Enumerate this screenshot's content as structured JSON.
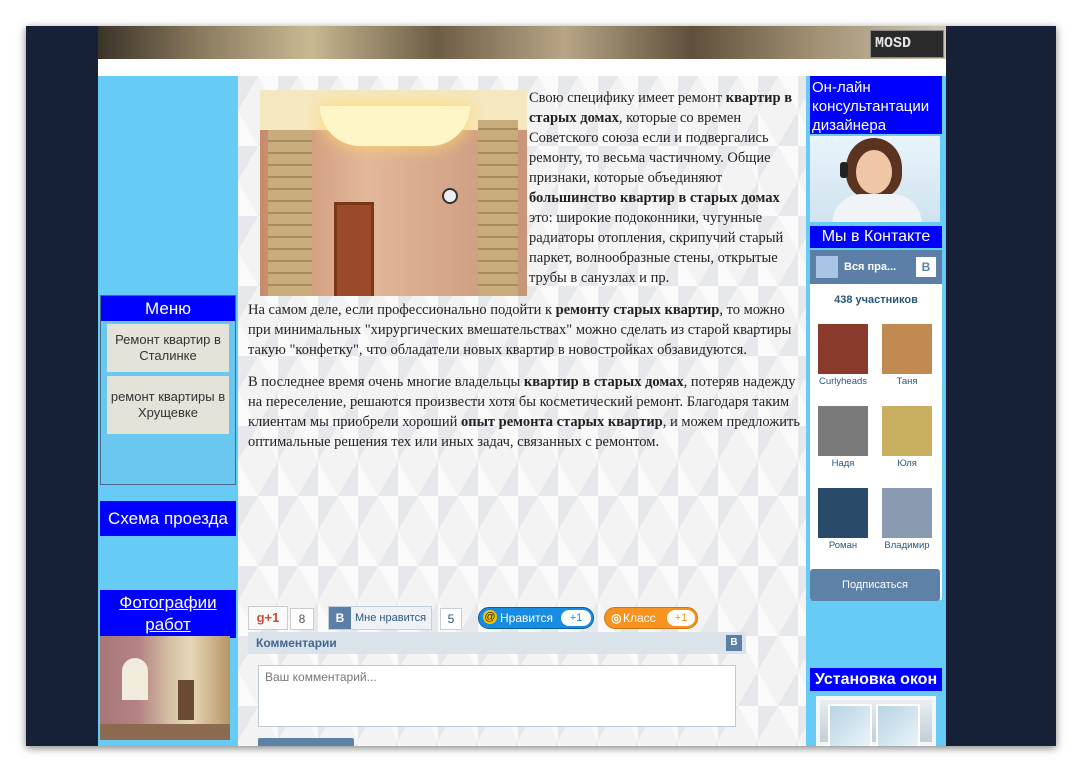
{
  "header": {
    "logo_text": "MOSD"
  },
  "left": {
    "menu_title": "Меню",
    "menu_items": [
      {
        "label": "Ремонт квартир в Сталинке"
      },
      {
        "label": "ремонт квартиры в Хрущевке"
      }
    ],
    "schema_link": "Схема проезда",
    "photos_link": "Фотографии работ"
  },
  "article": {
    "p1": [
      {
        "t": "Свою специфику имеет ремонт ",
        "b": false
      },
      {
        "t": "квартир в старых домах",
        "b": true
      },
      {
        "t": ", которые со времен Советского союза если и подвергались ремонту, то весьма частичному. Общие признаки, которые объединяют ",
        "b": false
      },
      {
        "t": "большинство квартир в старых домах",
        "b": true
      },
      {
        "t": " это: широкие подоконники, чугунные радиаторы отопления, скрипучий старый паркет, волнообразные стены, открытые трубы в санузлах и пр.",
        "b": false
      }
    ],
    "p2": [
      {
        "t": "На самом деле, если профессионально подойти к ",
        "b": false
      },
      {
        "t": "ремонту старых квартир",
        "b": true
      },
      {
        "t": ", то можно при минимальных \"хирургических вмешательствах\" можно сделать из старой квартиры такую \"конфетку\", что обладатели новых квартир в новостройках обзавидуются.",
        "b": false
      }
    ],
    "p3": [
      {
        "t": "В последнее время очень многие владельцы ",
        "b": false
      },
      {
        "t": "квартир в старых домах",
        "b": true
      },
      {
        "t": ", потеряв надежду на переселение, решаются произвести хотя бы косметический ремонт. Благодаря таким клиентам мы приобрели хороший ",
        "b": false
      },
      {
        "t": "опыт ремонта старых квартир",
        "b": true
      },
      {
        "t": ", и можем предложить оптимальные решения тех или иных задач, связанных с ремонтом.",
        "b": false
      }
    ]
  },
  "social": {
    "gplus_label": "g+1",
    "gplus_count": "8",
    "vk_label": "Мне нравится",
    "vk_icon": "B",
    "vk_count": "5",
    "mail_label": "Нравится",
    "mail_count": "+1",
    "ok_label": "Класс",
    "ok_count": "+1"
  },
  "comments": {
    "title": "Комментарии",
    "vk_icon": "B",
    "placeholder": "Ваш комментарий..."
  },
  "right": {
    "consult_title": "Он-лайн консультантации дизайнера",
    "vk_title": "Мы в Контакте",
    "vk_group_name": "Вся пра...",
    "vk_icon": "B",
    "members_count": "438 участников",
    "members": [
      {
        "name": "Curlyheads",
        "color": "#8a3a2a"
      },
      {
        "name": "Таня",
        "color": "#c08a50"
      },
      {
        "name": "Надя",
        "color": "#7a7a7a"
      },
      {
        "name": "Юля",
        "color": "#c9b060"
      },
      {
        "name": "Роман",
        "color": "#2a4a6a"
      },
      {
        "name": "Владимир",
        "color": "#8a9ab0"
      }
    ],
    "subscribe_label": "Подписаться",
    "windows_title": "Установка окон"
  }
}
